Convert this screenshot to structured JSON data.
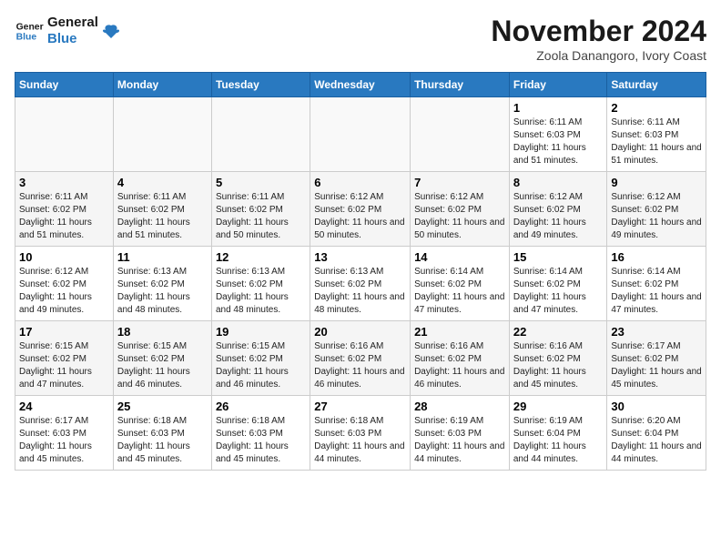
{
  "logo": {
    "line1": "General",
    "line2": "Blue"
  },
  "title": "November 2024",
  "subtitle": "Zoola Danangoro, Ivory Coast",
  "days_of_week": [
    "Sunday",
    "Monday",
    "Tuesday",
    "Wednesday",
    "Thursday",
    "Friday",
    "Saturday"
  ],
  "weeks": [
    [
      {
        "day": "",
        "info": ""
      },
      {
        "day": "",
        "info": ""
      },
      {
        "day": "",
        "info": ""
      },
      {
        "day": "",
        "info": ""
      },
      {
        "day": "",
        "info": ""
      },
      {
        "day": "1",
        "info": "Sunrise: 6:11 AM\nSunset: 6:03 PM\nDaylight: 11 hours and 51 minutes."
      },
      {
        "day": "2",
        "info": "Sunrise: 6:11 AM\nSunset: 6:03 PM\nDaylight: 11 hours and 51 minutes."
      }
    ],
    [
      {
        "day": "3",
        "info": "Sunrise: 6:11 AM\nSunset: 6:02 PM\nDaylight: 11 hours and 51 minutes."
      },
      {
        "day": "4",
        "info": "Sunrise: 6:11 AM\nSunset: 6:02 PM\nDaylight: 11 hours and 51 minutes."
      },
      {
        "day": "5",
        "info": "Sunrise: 6:11 AM\nSunset: 6:02 PM\nDaylight: 11 hours and 50 minutes."
      },
      {
        "day": "6",
        "info": "Sunrise: 6:12 AM\nSunset: 6:02 PM\nDaylight: 11 hours and 50 minutes."
      },
      {
        "day": "7",
        "info": "Sunrise: 6:12 AM\nSunset: 6:02 PM\nDaylight: 11 hours and 50 minutes."
      },
      {
        "day": "8",
        "info": "Sunrise: 6:12 AM\nSunset: 6:02 PM\nDaylight: 11 hours and 49 minutes."
      },
      {
        "day": "9",
        "info": "Sunrise: 6:12 AM\nSunset: 6:02 PM\nDaylight: 11 hours and 49 minutes."
      }
    ],
    [
      {
        "day": "10",
        "info": "Sunrise: 6:12 AM\nSunset: 6:02 PM\nDaylight: 11 hours and 49 minutes."
      },
      {
        "day": "11",
        "info": "Sunrise: 6:13 AM\nSunset: 6:02 PM\nDaylight: 11 hours and 48 minutes."
      },
      {
        "day": "12",
        "info": "Sunrise: 6:13 AM\nSunset: 6:02 PM\nDaylight: 11 hours and 48 minutes."
      },
      {
        "day": "13",
        "info": "Sunrise: 6:13 AM\nSunset: 6:02 PM\nDaylight: 11 hours and 48 minutes."
      },
      {
        "day": "14",
        "info": "Sunrise: 6:14 AM\nSunset: 6:02 PM\nDaylight: 11 hours and 47 minutes."
      },
      {
        "day": "15",
        "info": "Sunrise: 6:14 AM\nSunset: 6:02 PM\nDaylight: 11 hours and 47 minutes."
      },
      {
        "day": "16",
        "info": "Sunrise: 6:14 AM\nSunset: 6:02 PM\nDaylight: 11 hours and 47 minutes."
      }
    ],
    [
      {
        "day": "17",
        "info": "Sunrise: 6:15 AM\nSunset: 6:02 PM\nDaylight: 11 hours and 47 minutes."
      },
      {
        "day": "18",
        "info": "Sunrise: 6:15 AM\nSunset: 6:02 PM\nDaylight: 11 hours and 46 minutes."
      },
      {
        "day": "19",
        "info": "Sunrise: 6:15 AM\nSunset: 6:02 PM\nDaylight: 11 hours and 46 minutes."
      },
      {
        "day": "20",
        "info": "Sunrise: 6:16 AM\nSunset: 6:02 PM\nDaylight: 11 hours and 46 minutes."
      },
      {
        "day": "21",
        "info": "Sunrise: 6:16 AM\nSunset: 6:02 PM\nDaylight: 11 hours and 46 minutes."
      },
      {
        "day": "22",
        "info": "Sunrise: 6:16 AM\nSunset: 6:02 PM\nDaylight: 11 hours and 45 minutes."
      },
      {
        "day": "23",
        "info": "Sunrise: 6:17 AM\nSunset: 6:02 PM\nDaylight: 11 hours and 45 minutes."
      }
    ],
    [
      {
        "day": "24",
        "info": "Sunrise: 6:17 AM\nSunset: 6:03 PM\nDaylight: 11 hours and 45 minutes."
      },
      {
        "day": "25",
        "info": "Sunrise: 6:18 AM\nSunset: 6:03 PM\nDaylight: 11 hours and 45 minutes."
      },
      {
        "day": "26",
        "info": "Sunrise: 6:18 AM\nSunset: 6:03 PM\nDaylight: 11 hours and 45 minutes."
      },
      {
        "day": "27",
        "info": "Sunrise: 6:18 AM\nSunset: 6:03 PM\nDaylight: 11 hours and 44 minutes."
      },
      {
        "day": "28",
        "info": "Sunrise: 6:19 AM\nSunset: 6:03 PM\nDaylight: 11 hours and 44 minutes."
      },
      {
        "day": "29",
        "info": "Sunrise: 6:19 AM\nSunset: 6:04 PM\nDaylight: 11 hours and 44 minutes."
      },
      {
        "day": "30",
        "info": "Sunrise: 6:20 AM\nSunset: 6:04 PM\nDaylight: 11 hours and 44 minutes."
      }
    ]
  ]
}
